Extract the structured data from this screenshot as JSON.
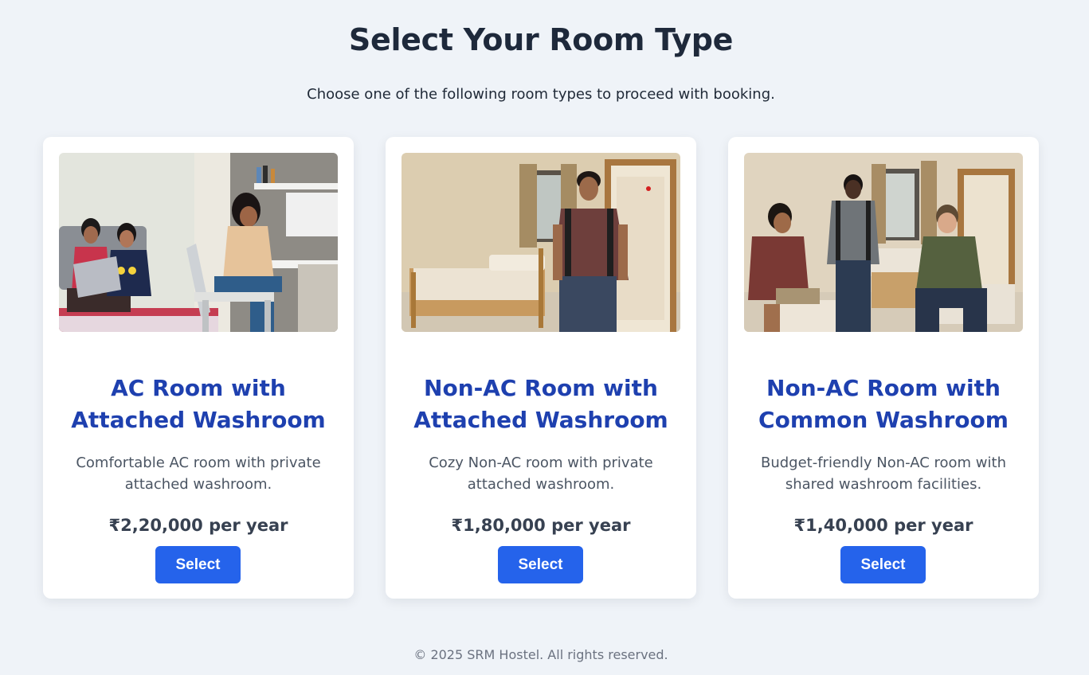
{
  "header": {
    "title": "Select Your Room Type",
    "subtitle": "Choose one of the following room types to proceed with booking."
  },
  "rooms": [
    {
      "title": "AC Room with Attached Washroom",
      "description": "Comfortable AC room with private attached washroom.",
      "price": "₹2,20,000 per year",
      "button_label": "Select"
    },
    {
      "title": "Non-AC Room with Attached Washroom",
      "description": "Cozy Non-AC room with private attached washroom.",
      "price": "₹1,80,000 per year",
      "button_label": "Select"
    },
    {
      "title": "Non-AC Room with Common Washroom",
      "description": "Budget-friendly Non-AC room with shared washroom facilities.",
      "price": "₹1,40,000 per year",
      "button_label": "Select"
    }
  ],
  "footer": {
    "text": "© 2025 SRM Hostel. All rights reserved."
  },
  "colors": {
    "background": "#eff3f8",
    "title": "#1e293b",
    "card_title": "#1e40af",
    "button": "#2563eb"
  }
}
